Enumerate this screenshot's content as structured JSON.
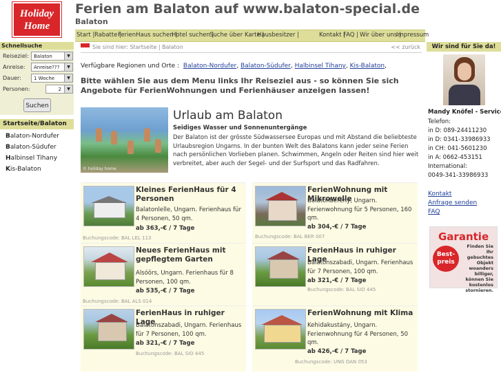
{
  "header": {
    "logo_line1": "Holiday",
    "logo_line2": "Home",
    "title": "Ferien am Balaton auf www.balaton-special.de",
    "subtitle": "Balaton"
  },
  "topnav": {
    "items": [
      "Start |",
      "Rabatte |",
      "FerienHaus suchen |",
      "Hotel suchen |",
      "Suche über Karte |",
      "Hausbesitzer |",
      "Kontakt |",
      "FAQ |",
      "Wir über uns |",
      "Impressum"
    ]
  },
  "quicksearch": {
    "title": "Schnellsuche",
    "fields": [
      {
        "label": "Reiseziel:",
        "value": "Balaton"
      },
      {
        "label": "Anreise:",
        "value": "Anreise???"
      },
      {
        "label": "Dauer:",
        "value": "1 Woche"
      },
      {
        "label": "Personen:",
        "value": "2"
      }
    ],
    "button": "Suchen"
  },
  "leftnav": {
    "title": "Startseite/Balaton",
    "items": [
      {
        "first": "B",
        "rest": "alaton-Nordufer"
      },
      {
        "first": "B",
        "rest": "alaton-Südufer"
      },
      {
        "first": "H",
        "rest": "albinsel Tihany"
      },
      {
        "first": "K",
        "rest": "is-Balaton"
      }
    ]
  },
  "breadcrumb": {
    "text": "Sie sind hier: Startseite | Balaton",
    "back": "<< zurück"
  },
  "main": {
    "regions_label": "Verfügbare Regionen und Orte :",
    "regions": [
      "Balaton-Nordufer",
      "Balaton-Südufer",
      "Halbinsel Tihany",
      "Kis-Balaton"
    ],
    "regions_end": ",",
    "intro": "Bitte wählen Sie aus dem Menu links Ihr Reiseziel aus - so können Sie sich Angebote für FerienWohnungen und Ferienhäuser anzeigen lassen!",
    "hero_watermark": "© holiday home",
    "hero_title": "Urlaub am Balaton",
    "hero_subtitle": "Seidiges Wasser und Sonnenuntergänge",
    "hero_text": "Der Balaton ist der grösste Südwassersee Europas und mit Abstand die beliebteste Urlaubsregion Ungarns. In der bunten Welt des Balatons kann jeder seine Ferien nach persönlichen Vorlieben planen. Schwimmen, Angeln oder Reiten sind hier weit verbreitet, aber auch der Segel- und der Surfsport und das Radfahren."
  },
  "listings": [
    {
      "title": "Kleines FerienHaus für 4 Personen",
      "desc": "Balatonlelle, Ungarn. Ferienhaus für 4 Personen, 50 qm.",
      "price": "ab 363,-€ / 7 Tage",
      "code": "Buchungscode: BAL LEL 113"
    },
    {
      "title": "FerienWohnung mit Mikrowelle",
      "desc": "Balatonberény, Ungarn. Ferienwohnung für 5 Personen, 160 qm.",
      "price": "ab 304,-€ / 7 Tage",
      "code": "Buchungscode: BAL BER 007"
    },
    {
      "title": "Neues FerienHaus mit gepflegtem Garten",
      "desc": "Alsóörs, Ungarn. Ferienhaus für 8 Personen, 100 qm.",
      "price": "ab 535,-€ / 7 Tage",
      "code": "Buchungscode: BAL ALS 014"
    },
    {
      "title": "FerienHaus in ruhiger Lage",
      "desc": "Balatonszabadi, Ungarn. Ferienhaus für 7 Personen, 100 qm.",
      "price": "ab 321,-€ / 7 Tage",
      "code": "Buchungscode: BAL SIO 445"
    },
    {
      "title": "FerienHaus in ruhiger Lage",
      "desc": "Balatonszabadi, Ungarn. Ferienhaus für 7 Personen, 100 qm.",
      "price": "ab 321,-€ / 7 Tage",
      "code": "Buchungscode: BAL SIO 445"
    },
    {
      "title": "FerienWohnung mit Klima",
      "desc": "Kehidakustány, Ungarn. Ferienwohnung für 4 Personen, 50 qm.",
      "price": "ab 426,-€ / 7 Tage",
      "code": "Buchungscode: UNG DAN 053"
    }
  ],
  "sidebar_right": {
    "title": "Wir sind für Sie da!",
    "name": "Mandy Knöfel - Service",
    "lines": [
      "Telefon:",
      "in D: 089-24411230",
      "in D: 0341-33986933",
      "in CH: 041-5601230",
      "in A: 0662-453151",
      "International:",
      "0049-341-33986933"
    ],
    "links": [
      "Kontakt",
      "Anfrage senden",
      "FAQ"
    ],
    "guarantee_title": "Garantie",
    "guarantee_seal": "Best-preis",
    "guarantee_text": "Finden Sie Ihr gebuchtes Objekt woanders billiger, können Sie kostenlos stornieren."
  }
}
